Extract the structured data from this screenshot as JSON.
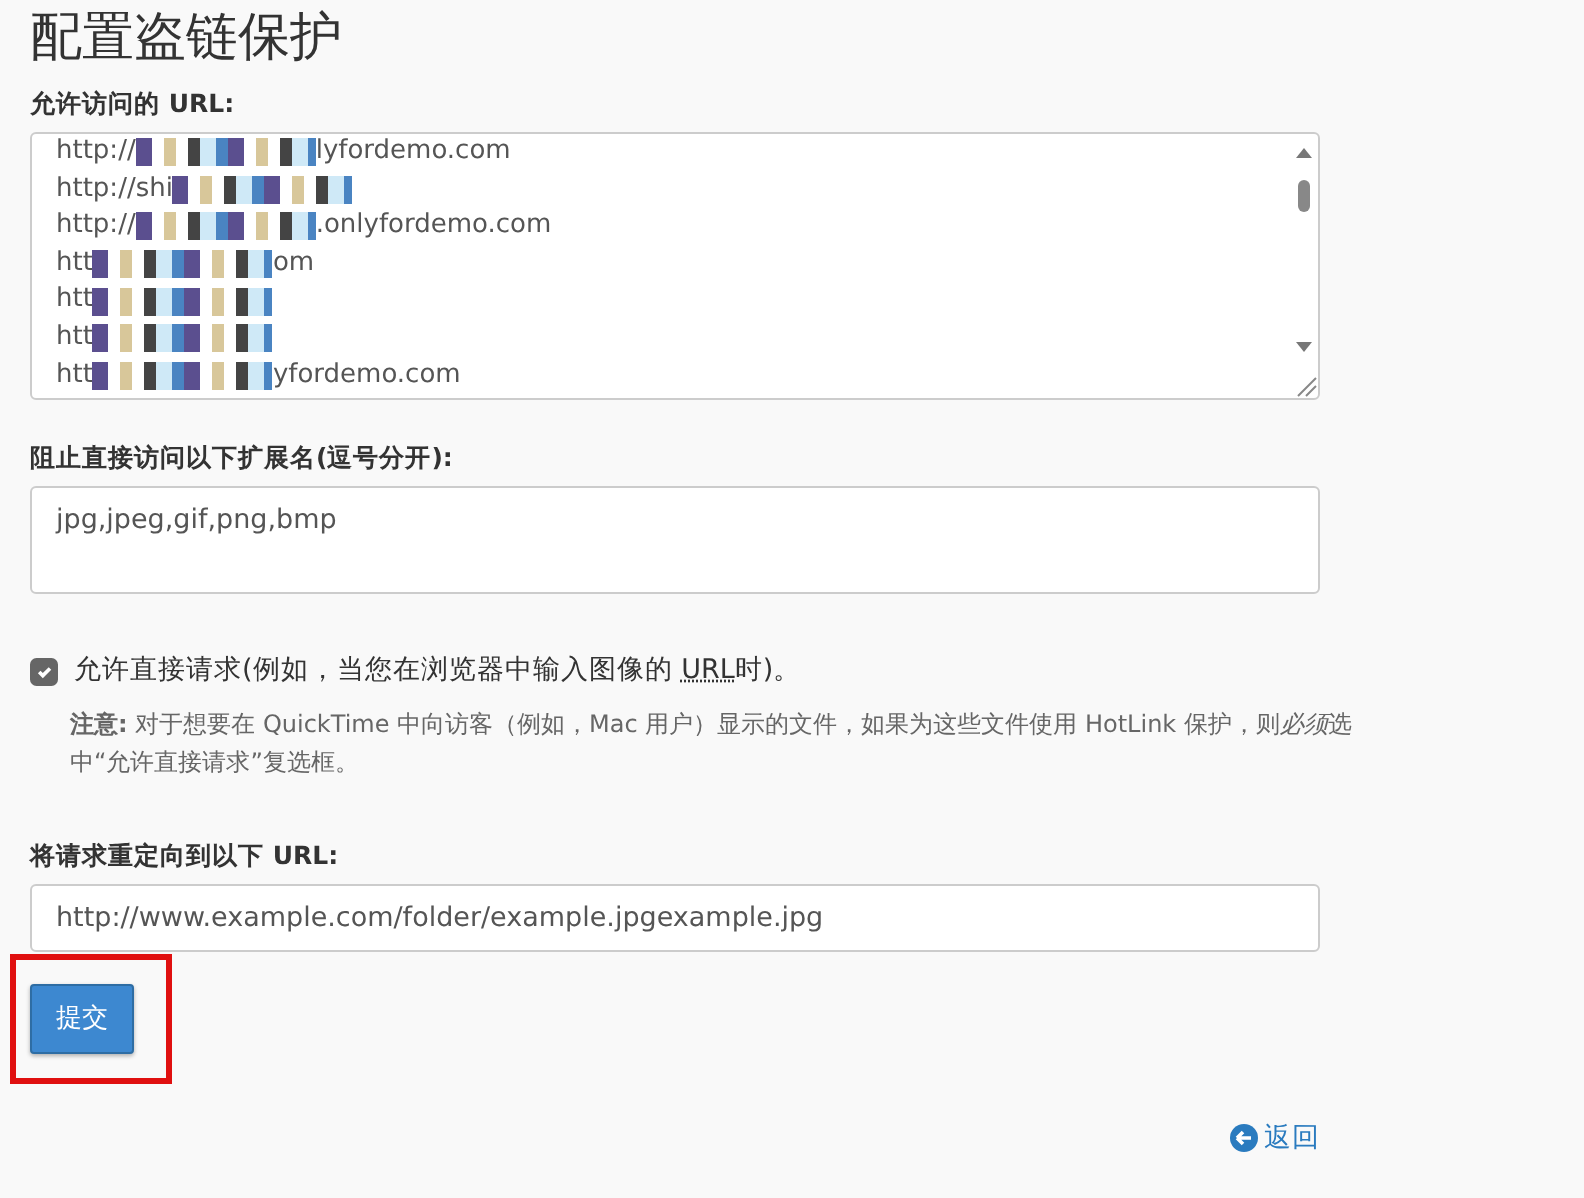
{
  "title": "配置盗链保护",
  "allowed_urls": {
    "label": "允许访问的 URL:",
    "lines": [
      {
        "prefix": "http://",
        "suffix": "lyfordemo.com"
      },
      {
        "prefix": "http://shi"
      },
      {
        "prefix": "http://",
        "suffix": ".onlyfordemo.com"
      },
      {
        "prefix": "htt",
        "suffix": "om"
      },
      {
        "prefix": "htt"
      },
      {
        "prefix": "htt"
      },
      {
        "prefix": "htt",
        "suffix": "yfordemo.com"
      }
    ]
  },
  "extensions": {
    "label": "阻止直接访问以下扩展名(逗号分开):",
    "value": "jpg,jpeg,gif,png,bmp"
  },
  "direct_request": {
    "checked": true,
    "label_before": "允许直接请求(例如，当您在浏览器中输入图像的 ",
    "label_abbr": "URL",
    "label_after": "时)。",
    "note": [
      {
        "kind": "strong",
        "text": "注意:"
      },
      {
        "kind": "plain",
        "text": " 对于想要在 QuickTime 中向访客（例如，Mac 用户）显示的文件，如果为这些文件使用 HotLink 保护，则"
      },
      {
        "kind": "emphasis",
        "text": "必须"
      },
      {
        "kind": "plain",
        "text": "选中“允许直接请求”复选框。"
      }
    ]
  },
  "redirect": {
    "label": "将请求重定向到以下 URL:",
    "value": "http://www.example.com/folder/example.jpgexample.jpg"
  },
  "submit": {
    "label": "提交",
    "highlighted": true
  },
  "back_link": "返回"
}
